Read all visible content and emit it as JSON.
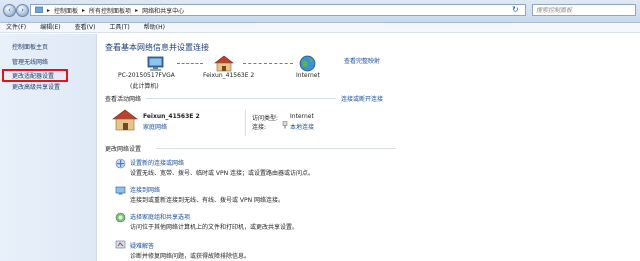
{
  "window": {
    "breadcrumb": [
      "控制面板",
      "所有控制面板项",
      "网络和共享中心"
    ],
    "search_placeholder": "搜索控制面板"
  },
  "menu": [
    "文件(F)",
    "编辑(E)",
    "查看(V)",
    "工具(T)",
    "帮助(H)"
  ],
  "sidebar": {
    "items": [
      "控制面板主页",
      "管理无线网络",
      "更改适配器设置",
      "更改高级共享设置"
    ]
  },
  "main": {
    "title": "查看基本网络信息并设置连接",
    "view_full_map": "查看完整映射",
    "map": {
      "computer_name": "PC-20150517FVGA",
      "computer_sub": "(此计算机)",
      "network_name": "Feixun_41563E  2",
      "internet": "Internet"
    },
    "active_header": "查看活动网络",
    "connect_disconnect": "连接或断开连接",
    "active": {
      "name": "Feixun_41563E  2",
      "type": "家庭网络",
      "access_label": "访问类型:",
      "access_value": "Internet",
      "conn_label": "连接:",
      "conn_value": "本地连接"
    },
    "change_header": "更改网络设置",
    "tasks": [
      {
        "title": "设置新的连接或网络",
        "desc": "设置无线、宽带、拨号、临时或 VPN 连接；或设置路由器或访问点。"
      },
      {
        "title": "连接到网络",
        "desc": "连接到或重新连接到无线、有线、拨号或 VPN 网络连接。"
      },
      {
        "title": "选择家庭组和共享选项",
        "desc": "访问位于其他网络计算机上的文件和打印机，或更改共享设置。"
      },
      {
        "title": "疑难解答",
        "desc": "诊断并修复网络问题，或获得故障排除信息。"
      }
    ]
  }
}
